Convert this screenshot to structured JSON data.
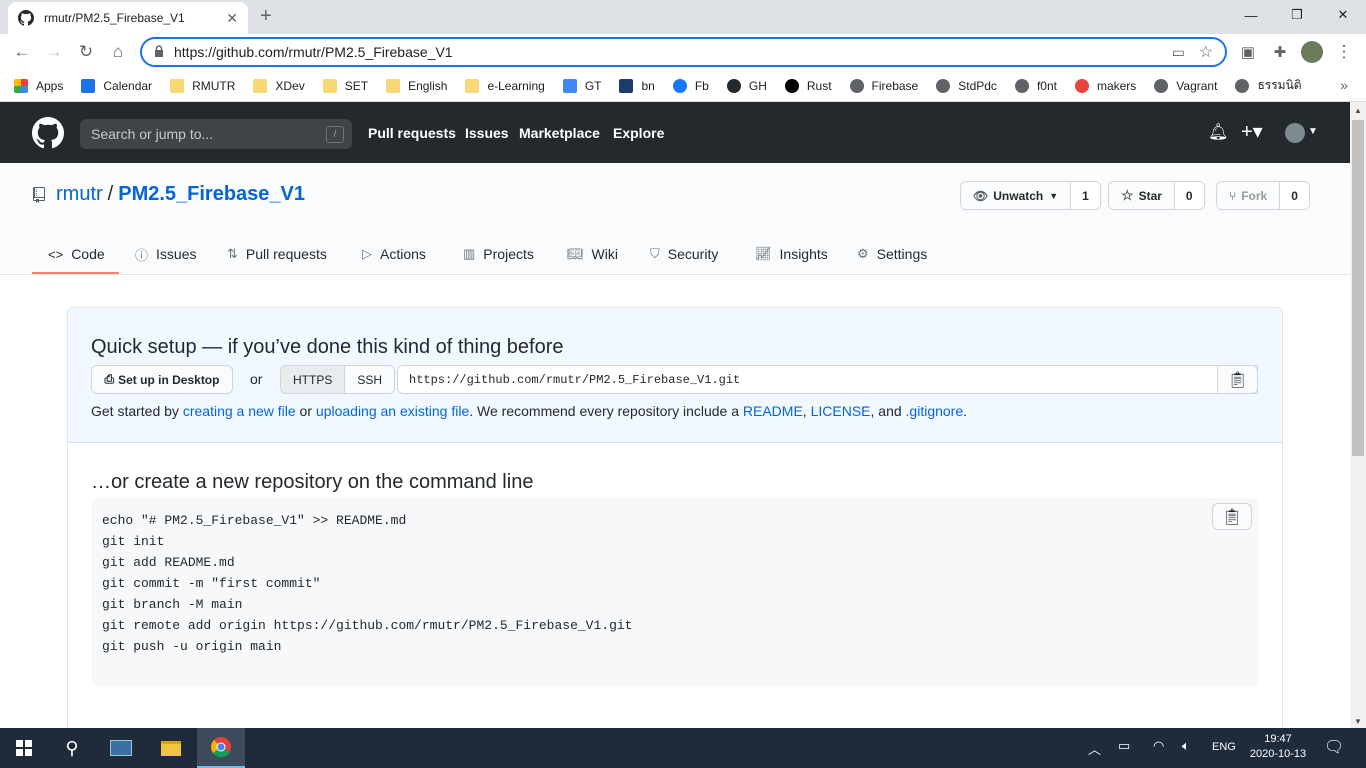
{
  "browser": {
    "tab_title": "rmutr/PM2.5_Firebase_V1",
    "new_tab": "+",
    "close_tab": "✕",
    "url": "https://github.com/rmutr/PM2.5_Firebase_V1"
  },
  "bookmarks": [
    {
      "label": "Apps",
      "icon": "apps-grid-icon"
    },
    {
      "label": "Calendar",
      "icon": "calendar-icon"
    },
    {
      "label": "RMUTR",
      "icon": "folder-icon"
    },
    {
      "label": "XDev",
      "icon": "folder-icon"
    },
    {
      "label": "SET",
      "icon": "folder-icon"
    },
    {
      "label": "English",
      "icon": "folder-icon"
    },
    {
      "label": "e-Learning",
      "icon": "folder-icon"
    },
    {
      "label": "GT",
      "icon": "translate-icon"
    },
    {
      "label": "bn",
      "icon": "bn-icon"
    },
    {
      "label": "Fb",
      "icon": "facebook-icon"
    },
    {
      "label": "GH",
      "icon": "github-icon"
    },
    {
      "label": "Rust",
      "icon": "rust-icon"
    },
    {
      "label": "Firebase",
      "icon": "globe-icon"
    },
    {
      "label": "StdPdc",
      "icon": "globe-icon"
    },
    {
      "label": "f0nt",
      "icon": "globe-icon"
    },
    {
      "label": "makers",
      "icon": "makers-icon"
    },
    {
      "label": "Vagrant",
      "icon": "globe-icon"
    },
    {
      "label": "ธรรมนิติ",
      "icon": "globe-icon"
    }
  ],
  "github": {
    "search_placeholder": "Search or jump to...",
    "search_key": "/",
    "nav": [
      "Pull requests",
      "Issues",
      "Marketplace",
      "Explore"
    ],
    "owner": "rmutr",
    "separator": "/",
    "repo": "PM2.5_Firebase_V1",
    "unwatch": {
      "label": "Unwatch",
      "count": "1"
    },
    "star": {
      "label": "Star",
      "count": "0"
    },
    "fork": {
      "label": "Fork",
      "count": "0"
    },
    "tabs": [
      "Code",
      "Issues",
      "Pull requests",
      "Actions",
      "Projects",
      "Wiki",
      "Security",
      "Insights",
      "Settings"
    ]
  },
  "setup": {
    "title": "Quick setup — if you’ve done this kind of thing before",
    "desktop_btn": "Set up in Desktop",
    "or": "or",
    "https": "HTTPS",
    "ssh": "SSH",
    "clone_url": "https://github.com/rmutr/PM2.5_Firebase_V1.git",
    "text_1": "Get started by ",
    "link_new_file": "creating a new file",
    "text_2": " or ",
    "link_upload": "uploading an existing file",
    "text_3": ". We recommend every repository include a ",
    "link_readme": "README",
    "text_4": ", ",
    "link_license": "LICENSE",
    "text_5": ", and ",
    "link_gitignore": ".gitignore",
    "text_6": "."
  },
  "cmdline": {
    "title": "…or create a new repository on the command line",
    "lines": [
      "echo \"# PM2.5_Firebase_V1\" >> README.md",
      "git init",
      "git add README.md",
      "git commit -m \"first commit\"",
      "git branch -M main",
      "git remote add origin https://github.com/rmutr/PM2.5_Firebase_V1.git",
      "git push -u origin main"
    ]
  },
  "taskbar": {
    "lang": "ENG",
    "time": "19:47",
    "date": "2020-10-13"
  }
}
